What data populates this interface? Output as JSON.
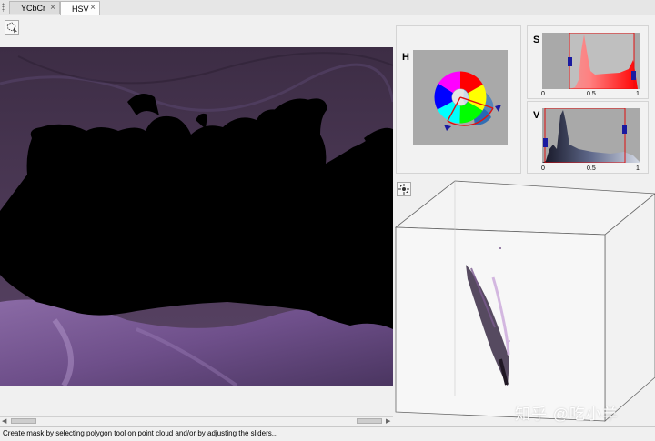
{
  "tabs": [
    {
      "label": "YCbCr",
      "active": false
    },
    {
      "label": "HSV",
      "active": true
    }
  ],
  "status": {
    "text": "Create mask by selecting polygon tool on point cloud and/or by adjusting the sliders..."
  },
  "histograms": {
    "h": {
      "label": "H"
    },
    "s": {
      "label": "S",
      "ticks": [
        "0",
        "0.5",
        "1"
      ]
    },
    "v": {
      "label": "V",
      "ticks": [
        "0",
        "0.5",
        "1"
      ]
    }
  },
  "watermark": {
    "text": "知乎 @吃小羊"
  },
  "icons": {
    "tab_close": "close-icon",
    "polygon_tool": "polygon-select-icon",
    "rotate_tool": "rotate-pointcloud-icon"
  },
  "colors": {
    "accent_red": "#e01010",
    "slider_blue": "#1a1aa0",
    "plot_bg": "#a9a9a9"
  }
}
